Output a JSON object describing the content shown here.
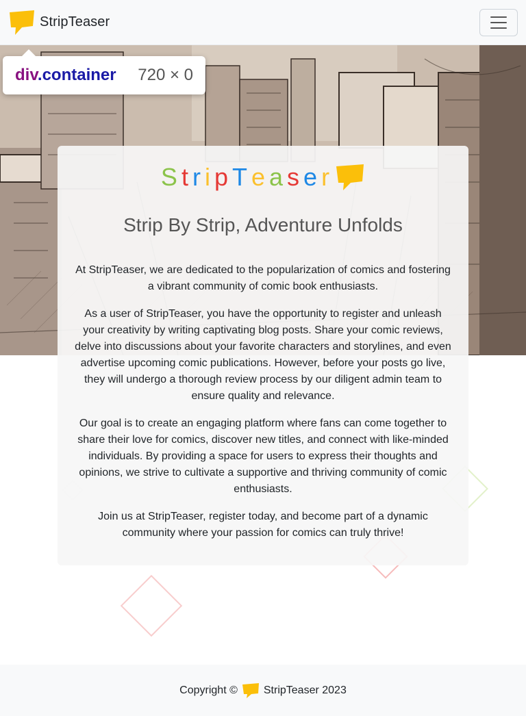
{
  "navbar": {
    "brand": "StripTeaser",
    "toggle_icon": "hamburger-icon"
  },
  "devtools_tooltip": {
    "tag": "div",
    "class_name": ".container",
    "dimensions": "720 × 0"
  },
  "card": {
    "logo_letters": [
      {
        "char": "S",
        "color": "#8bc34a"
      },
      {
        "char": "t",
        "color": "#e53935"
      },
      {
        "char": "r",
        "color": "#1e88e5"
      },
      {
        "char": "i",
        "color": "#fbc02d"
      },
      {
        "char": "p",
        "color": "#e53935"
      },
      {
        "char": "T",
        "color": "#1e88e5"
      },
      {
        "char": "e",
        "color": "#fbc02d"
      },
      {
        "char": "a",
        "color": "#8bc34a"
      },
      {
        "char": "s",
        "color": "#e53935"
      },
      {
        "char": "e",
        "color": "#1e88e5"
      },
      {
        "char": "r",
        "color": "#fbc02d"
      }
    ],
    "tagline": "Strip By Strip, Adventure Unfolds",
    "paragraphs": [
      "At StripTeaser, we are dedicated to the popularization of comics and fostering a vibrant community of comic book enthusiasts.",
      "As a user of StripTeaser, you have the opportunity to register and unleash your creativity by writing captivating blog posts. Share your comic reviews, delve into discussions about your favorite characters and storylines, and even advertise upcoming comic publications. However, before your posts go live, they will undergo a thorough review process by our diligent admin team to ensure quality and relevance.",
      "Our goal is to create an engaging platform where fans can come together to share their love for comics, discover new titles, and connect with like-minded individuals. By providing a space for users to express their thoughts and opinions, we strive to cultivate a supportive and thriving community of comic enthusiasts.",
      "Join us at StripTeaser, register today, and become part of a dynamic community where your passion for comics can truly thrive!"
    ]
  },
  "footer": {
    "copyright_prefix": "Copyright ©",
    "copyright_suffix": "StripTeaser 2023"
  },
  "colors": {
    "brand_yellow": "#fbbf0a",
    "navbar_bg": "#f8f9fa"
  }
}
